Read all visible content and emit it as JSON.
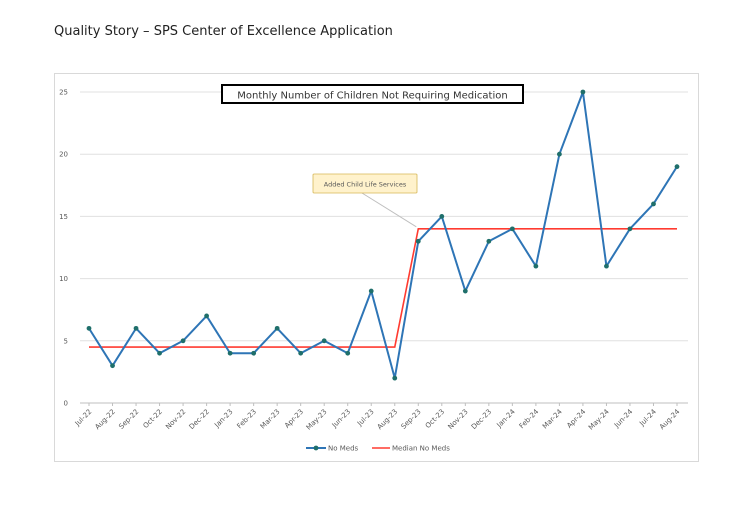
{
  "page": {
    "heading": "Quality Story – SPS Center of Excellence Application"
  },
  "chart_data": {
    "type": "line",
    "title": "Monthly Number of Children Not Requiring Medication",
    "xlabel": "",
    "ylabel": "",
    "ylim": [
      0,
      25
    ],
    "yticks": [
      0,
      5,
      10,
      15,
      20,
      25
    ],
    "grid": true,
    "legend_position": "bottom",
    "categories": [
      "Jul-22",
      "Aug-22",
      "Sep-22",
      "Oct-22",
      "Nov-22",
      "Dec-22",
      "Jan-23",
      "Feb-23",
      "Mar-23",
      "Apr-23",
      "May-23",
      "Jun-23",
      "Jul-23",
      "Aug-23",
      "Sep-23",
      "Oct-23",
      "Nov-23",
      "Dec-23",
      "Jan-24",
      "Feb-24",
      "Mar-24",
      "Apr-24",
      "May-24",
      "Jun-24",
      "Jul-24",
      "Aug-24"
    ],
    "series": [
      {
        "name": "No Meds",
        "color": "#2e75b6",
        "marker_color": "#1f6f6b",
        "values": [
          6,
          3,
          6,
          4,
          5,
          7,
          4,
          4,
          6,
          4,
          5,
          4,
          9,
          2,
          13,
          15,
          9,
          13,
          14,
          11,
          20,
          25,
          11,
          14,
          16,
          19
        ]
      },
      {
        "name": "Median No Meds",
        "color": "#ff3b30",
        "values": [
          4.5,
          4.5,
          4.5,
          4.5,
          4.5,
          4.5,
          4.5,
          4.5,
          4.5,
          4.5,
          4.5,
          4.5,
          4.5,
          4.5,
          14,
          14,
          14,
          14,
          14,
          14,
          14,
          14,
          14,
          14,
          14,
          14
        ]
      }
    ],
    "annotations": [
      {
        "text": "Added Child Life Services",
        "points_to_category": "Sep-23"
      }
    ]
  }
}
